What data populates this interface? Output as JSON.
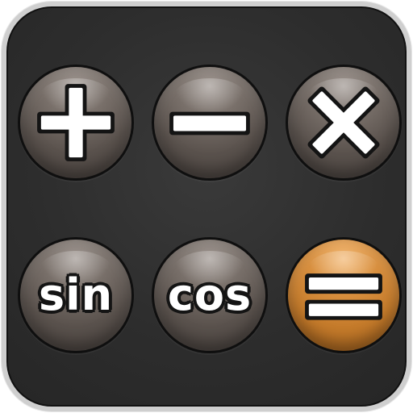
{
  "app_icon": {
    "buttons": [
      {
        "id": "add",
        "icon": "plus-icon",
        "label": ""
      },
      {
        "id": "subtract",
        "icon": "minus-icon",
        "label": ""
      },
      {
        "id": "multiply",
        "icon": "multiply-icon",
        "label": ""
      },
      {
        "id": "sin",
        "icon": "",
        "label": "sin"
      },
      {
        "id": "cos",
        "icon": "",
        "label": "cos"
      },
      {
        "id": "equals",
        "icon": "equals-icon",
        "label": ""
      }
    ]
  },
  "colors": {
    "background": "#2d2d2d",
    "border": "#cfcfcf",
    "button": "#6a625d",
    "equals_button": "#c47a2a",
    "glyph": "#ffffff",
    "glyph_outline": "#141414"
  }
}
